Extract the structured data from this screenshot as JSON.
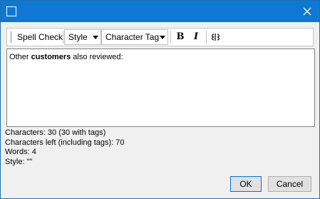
{
  "toolbar": {
    "spell_check": "Spell Check",
    "style_combo": "Style",
    "char_tag_combo": "Character Tag",
    "bold": "B",
    "italic": "I"
  },
  "editor": {
    "text_before": "Other ",
    "text_bold": "customers",
    "text_after": " also reviewed:"
  },
  "stats": {
    "characters": "Characters: 30 (30 with tags)",
    "characters_left": "Characters left (including tags): 70",
    "words": "Words: 4",
    "style": "Style: \"\""
  },
  "buttons": {
    "ok": "OK",
    "cancel": "Cancel"
  },
  "colors": {
    "titlebar": "#0f78d4",
    "window_bg": "#f0f0f0"
  }
}
